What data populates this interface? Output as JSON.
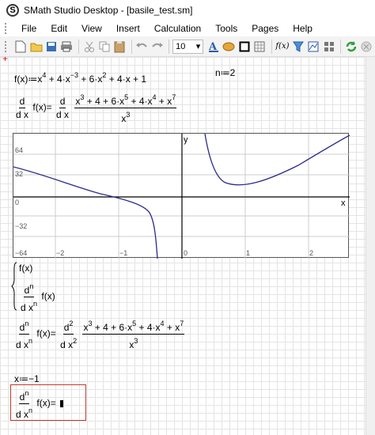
{
  "window": {
    "title": "SMath Studio Desktop - [basile_test.sm]"
  },
  "menu": {
    "items": [
      "File",
      "Edit",
      "View",
      "Insert",
      "Calculation",
      "Tools",
      "Pages",
      "Help"
    ]
  },
  "toolbar": {
    "font_size": "10",
    "fx_label": "f(x)"
  },
  "worksheet": {
    "eq1": {
      "lhs": "f(x)≔x",
      "rest": [
        "+ 4·x",
        "+ 6·x",
        "+ 4·x + 1"
      ],
      "exps": [
        "4",
        "−3",
        "2"
      ]
    },
    "n_def": "n≔2",
    "eq2": {
      "d": "d",
      "dx": "d x",
      "fx": "f(x)=",
      "den": "x",
      "den_exp": "3",
      "num_parts": [
        "x",
        "+ 4 + 6·x",
        "+ 4·x",
        "+ x"
      ],
      "num_exps": [
        "3",
        "5",
        "4",
        "7"
      ]
    },
    "plot": {
      "y_ticks": [
        "64",
        "32",
        "0",
        "−32",
        "−64"
      ],
      "x_ticks": [
        "−2",
        "−1",
        "0",
        "1",
        "2"
      ],
      "x_axis": "x",
      "y_axis": "y"
    },
    "system": {
      "fx": "f(x)",
      "d": "d",
      "n": "n",
      "dx": "d x",
      "fx2": "f(x)"
    },
    "eq3": {
      "fx": "f(x)=",
      "d": "d",
      "dx": "d x",
      "n": "n",
      "two": "2",
      "num_parts": [
        "x",
        "+ 4 + 6·x",
        "+ 4·x",
        "+ x"
      ],
      "num_exps": [
        "3",
        "5",
        "4",
        "7"
      ],
      "den": "x",
      "den_exp": "3"
    },
    "x_def": "x≔−1",
    "eq4": {
      "d": "d",
      "dx": "d x",
      "n": "n",
      "fx": "f(x)="
    }
  }
}
